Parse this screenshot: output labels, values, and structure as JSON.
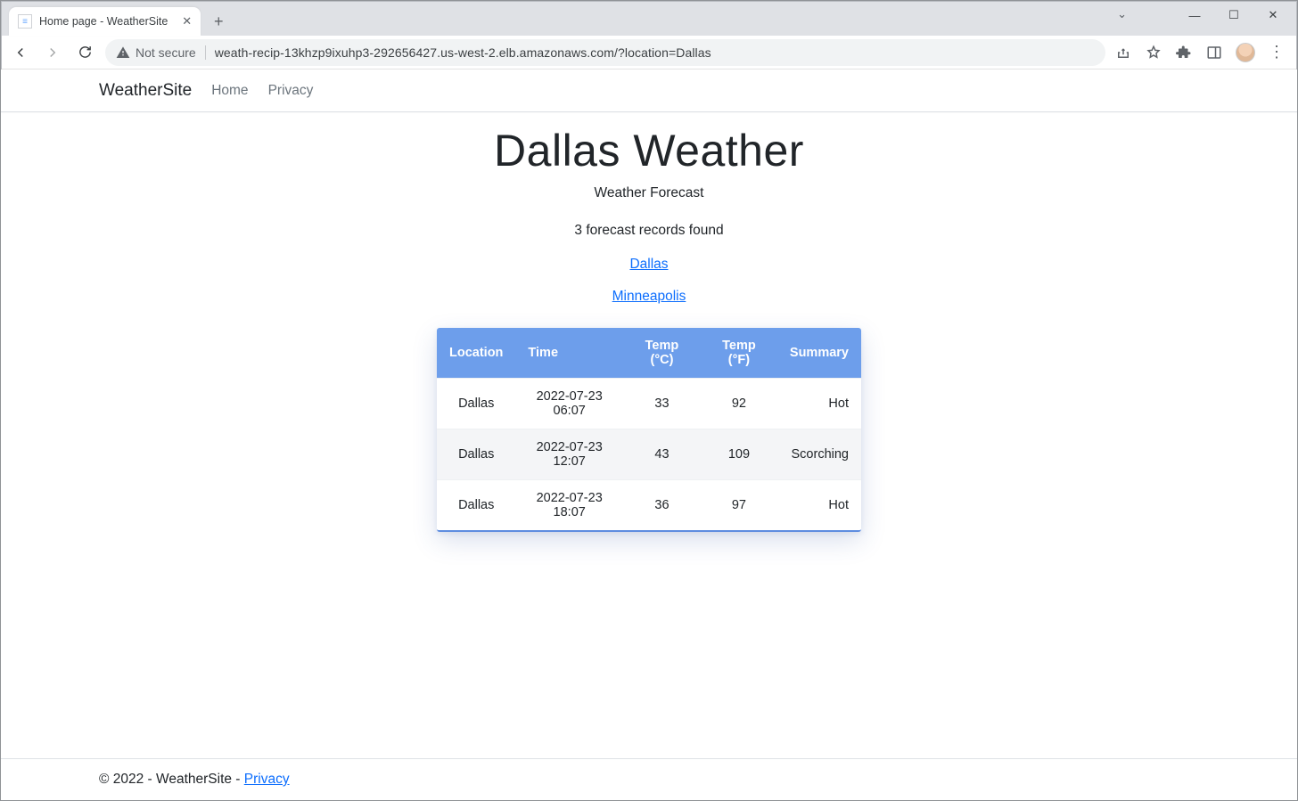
{
  "browser": {
    "tab_title": "Home page - WeatherSite",
    "not_secure_label": "Not secure",
    "url": "weath-recip-13khzp9ixuhp3-292656427.us-west-2.elb.amazonaws.com/?location=Dallas"
  },
  "nav": {
    "brand": "WeatherSite",
    "home": "Home",
    "privacy": "Privacy"
  },
  "page": {
    "heading": "Dallas Weather",
    "subtitle": "Weather Forecast",
    "count_text": "3 forecast records found",
    "location_links": [
      "Dallas",
      "Minneapolis"
    ]
  },
  "table": {
    "headers": {
      "location": "Location",
      "time": "Time",
      "temp_c": "Temp (°C)",
      "temp_f": "Temp (°F)",
      "summary": "Summary"
    },
    "rows": [
      {
        "location": "Dallas",
        "time": "2022-07-23 06:07",
        "temp_c": "33",
        "temp_f": "92",
        "summary": "Hot"
      },
      {
        "location": "Dallas",
        "time": "2022-07-23 12:07",
        "temp_c": "43",
        "temp_f": "109",
        "summary": "Scorching"
      },
      {
        "location": "Dallas",
        "time": "2022-07-23 18:07",
        "temp_c": "36",
        "temp_f": "97",
        "summary": "Hot"
      }
    ]
  },
  "footer": {
    "text": "© 2022 - WeatherSite - ",
    "privacy": "Privacy"
  }
}
